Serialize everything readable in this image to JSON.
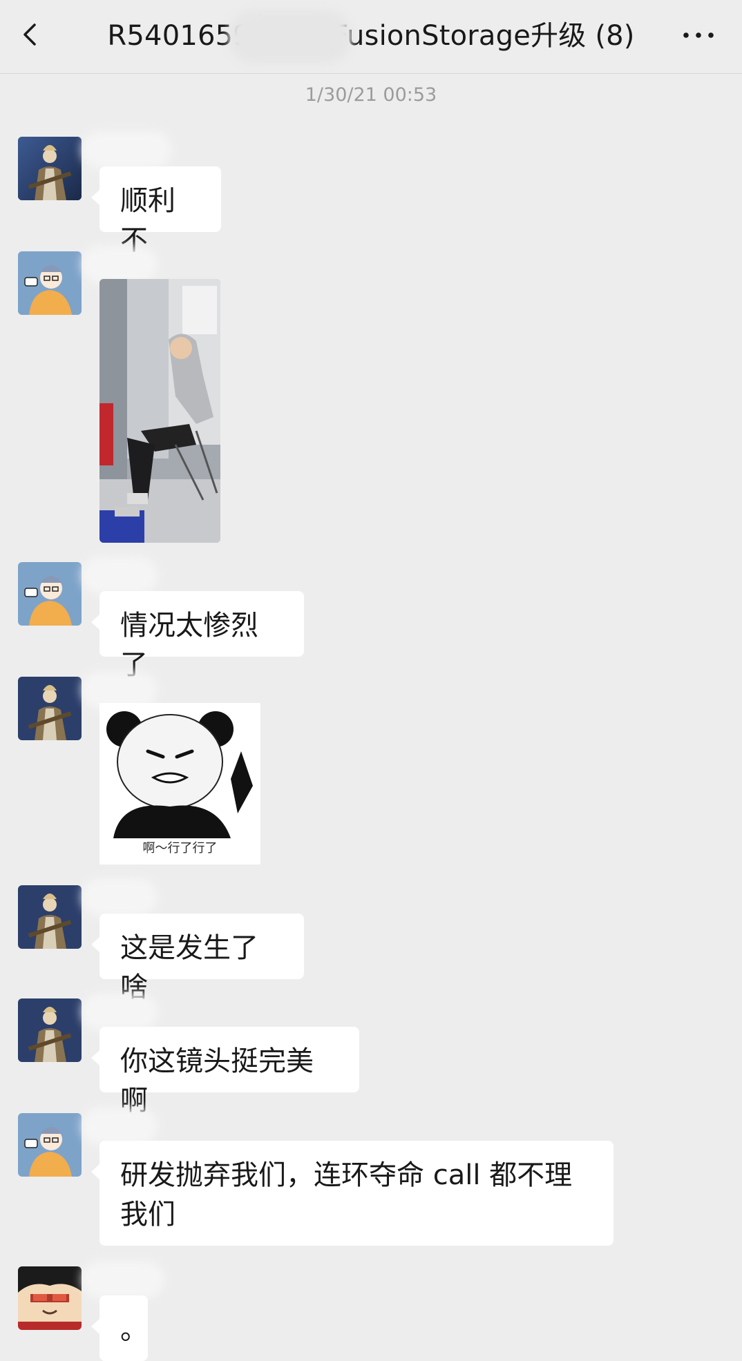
{
  "header": {
    "title": "R5401659",
    "title_suffix": "FusionStorage升级 (8)",
    "back_icon": "chevron-left-icon",
    "more_icon": "ellipsis-icon"
  },
  "timestamp": "1/30/21 00:53",
  "messages": [
    {
      "type": "text",
      "text": "顺利不"
    },
    {
      "type": "image",
      "description": "photo-message"
    },
    {
      "type": "text",
      "text": "情况太惨烈了"
    },
    {
      "type": "sticker",
      "caption": "啊～行了行了"
    },
    {
      "type": "text",
      "text": "这是发生了啥"
    },
    {
      "type": "text",
      "text": "你这镜头挺完美啊"
    },
    {
      "type": "text",
      "text": "研发抛弃我们，连环夺命 call 都不理我们"
    },
    {
      "type": "text",
      "text": "。"
    }
  ],
  "colors": {
    "background": "#ededed",
    "bubble": "#ffffff",
    "timestamp": "#9b9b9b"
  }
}
